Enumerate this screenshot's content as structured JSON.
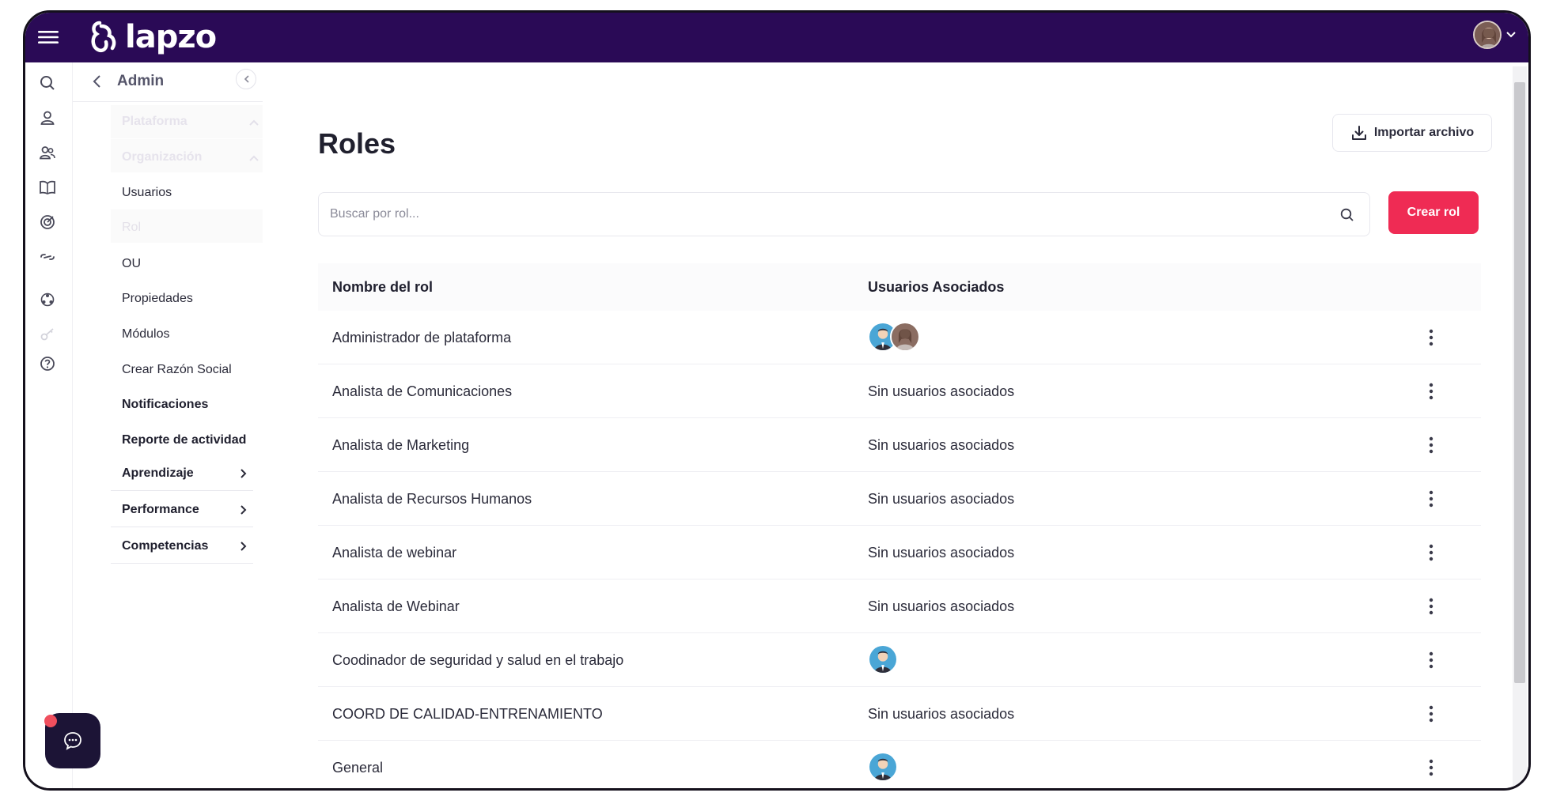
{
  "topbar": {
    "logo_text": "lapzo"
  },
  "sidebar": {
    "admin_label": "Admin",
    "sections": [
      {
        "label": "Plataforma"
      },
      {
        "label": "Organización"
      }
    ],
    "items": [
      {
        "label": "Usuarios"
      },
      {
        "label": "Rol"
      },
      {
        "label": "OU"
      },
      {
        "label": "Propiedades"
      },
      {
        "label": "Módulos"
      },
      {
        "label": "Crear Razón Social"
      },
      {
        "label": "Notificaciones"
      },
      {
        "label": "Reporte de actividad"
      }
    ],
    "groups": [
      {
        "label": "Aprendizaje"
      },
      {
        "label": "Performance"
      },
      {
        "label": "Competencias"
      }
    ]
  },
  "main": {
    "title": "Roles",
    "import_label": "Importar archivo",
    "search_placeholder": "Buscar por rol...",
    "create_label": "Crear rol",
    "columns": {
      "name": "Nombre del rol",
      "users": "Usuarios Asociados"
    },
    "rows": [
      {
        "name": "Administrador de plataforma",
        "users": "",
        "avatars": [
          "man",
          "woman"
        ]
      },
      {
        "name": "Analista de Comunicaciones",
        "users": "Sin usuarios asociados",
        "avatars": []
      },
      {
        "name": "Analista de Marketing",
        "users": "Sin usuarios asociados",
        "avatars": []
      },
      {
        "name": "Analista de Recursos Humanos",
        "users": "Sin usuarios asociados",
        "avatars": []
      },
      {
        "name": "Analista de webinar",
        "users": "Sin usuarios asociados",
        "avatars": []
      },
      {
        "name": "Analista de Webinar",
        "users": "Sin usuarios asociados",
        "avatars": []
      },
      {
        "name": "Coodinador de seguridad y salud en el trabajo",
        "users": "",
        "avatars": [
          "man"
        ]
      },
      {
        "name": "COORD DE CALIDAD-ENTRENAMIENTO",
        "users": "Sin usuarios asociados",
        "avatars": []
      },
      {
        "name": "General",
        "users": "",
        "avatars": [
          "man"
        ]
      }
    ]
  },
  "colors": {
    "topbar": "#2a0a56",
    "primary_button": "#ef2b54",
    "chat_button": "#1c1436"
  },
  "icons": [
    "menu-icon",
    "search-icon",
    "user-icon",
    "users-icon",
    "book-icon",
    "target-icon",
    "link-icon",
    "network-icon",
    "key-icon",
    "help-icon",
    "download-icon",
    "chat-icon",
    "kebab-icon"
  ]
}
